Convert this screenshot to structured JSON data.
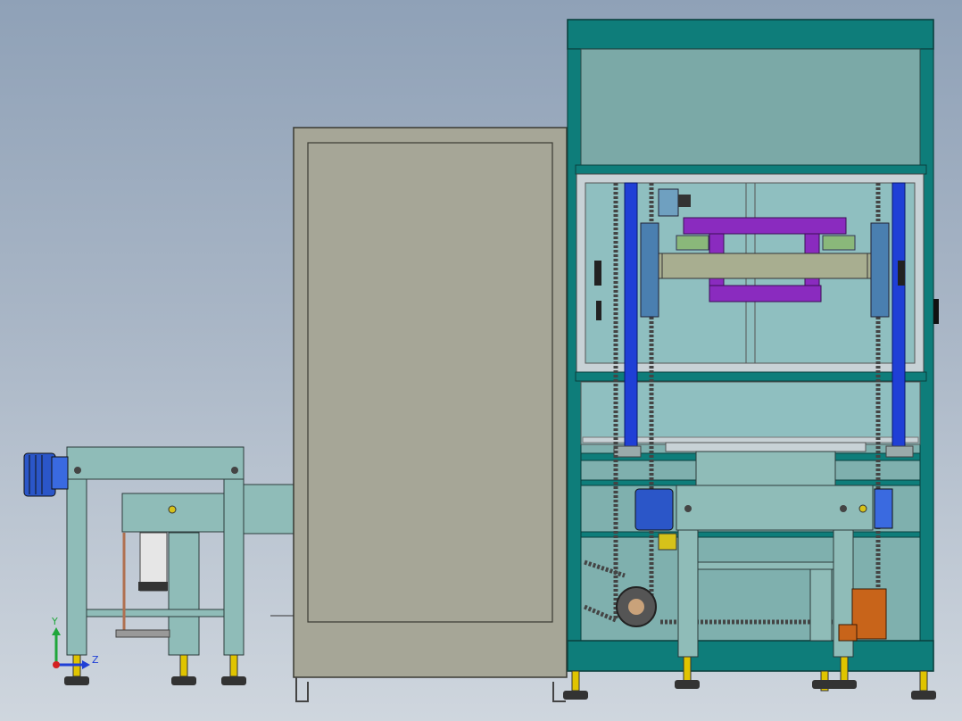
{
  "viewport": {
    "background_top": "#8fa1b7",
    "background_bottom": "#cfd6de"
  },
  "colors": {
    "frame_teal": "#0e7d7a",
    "frame_light": "#7fb0ae",
    "panel_grey": "#a6a697",
    "conveyor_teal": "#8fbcb8",
    "purple": "#8a2bbf",
    "blue_rail": "#1f3fd6",
    "chain": "#555555",
    "motor_blue": "#2b56c8",
    "feet_yellow": "#e0c400",
    "orange_motor": "#c8641a"
  },
  "triad": {
    "y_label": "Y",
    "z_label": "Z"
  }
}
